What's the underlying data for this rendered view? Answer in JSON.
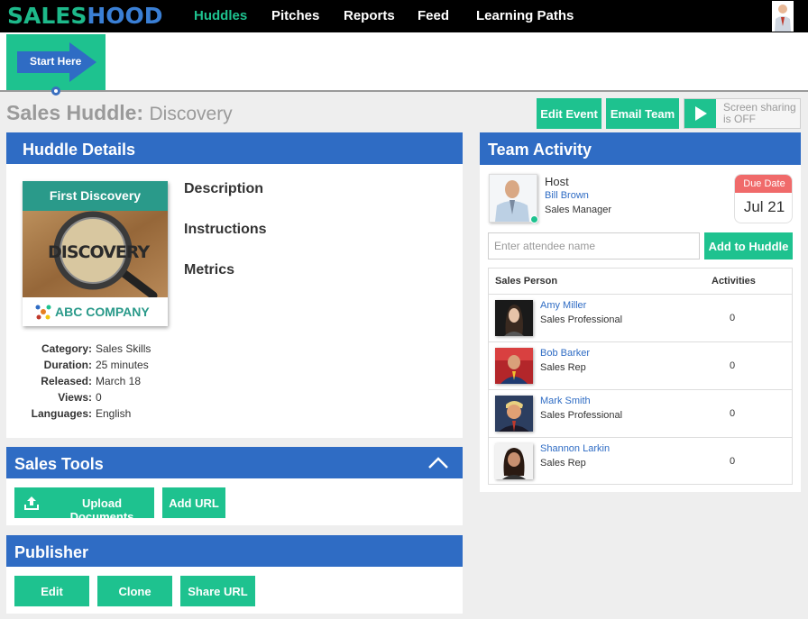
{
  "brand": {
    "logo_part1": "SALES",
    "logo_part2": "HOOD"
  },
  "nav": {
    "items": [
      {
        "label": "Huddles",
        "active": true
      },
      {
        "label": "Pitches",
        "active": false
      },
      {
        "label": "Reports",
        "active": false
      },
      {
        "label": "Feed",
        "active": false
      },
      {
        "label": "Learning Paths",
        "active": false
      }
    ]
  },
  "start_here": {
    "label": "Start Here"
  },
  "page": {
    "title_label": "Sales Huddle:",
    "title_value": "Discovery"
  },
  "actions": {
    "edit_event": "Edit Event",
    "email_team": "Email Team",
    "screen_sharing_line1": "Screen sharing",
    "screen_sharing_line2": "is OFF"
  },
  "huddle_details": {
    "header": "Huddle Details",
    "cover": {
      "title": "First Discovery",
      "image_text": "DISCOVERY",
      "company": "ABC COMPANY"
    },
    "sections": [
      "Description",
      "Instructions",
      "Metrics"
    ],
    "meta": [
      {
        "key": "Category:",
        "value": "Sales Skills"
      },
      {
        "key": "Duration:",
        "value": "25 minutes"
      },
      {
        "key": "Released:",
        "value": "March 18"
      },
      {
        "key": "Views:",
        "value": "0"
      },
      {
        "key": "Languages:",
        "value": "English"
      }
    ]
  },
  "sales_tools": {
    "header": "Sales Tools",
    "upload_label": "Upload Documents",
    "add_url_label": "Add URL",
    "icon": "chevron-up-icon"
  },
  "publisher": {
    "header": "Publisher",
    "edit_label": "Edit",
    "clone_label": "Clone",
    "share_url_label": "Share URL"
  },
  "team_activity": {
    "header": "Team Activity",
    "host": {
      "role_label": "Host",
      "name": "Bill Brown",
      "title": "Sales Manager"
    },
    "due": {
      "label": "Due Date",
      "date": "Jul 21"
    },
    "attendee_placeholder": "Enter attendee name",
    "add_button": "Add to Huddle",
    "table": {
      "col_person": "Sales Person",
      "col_activities": "Activities",
      "rows": [
        {
          "name": "Amy Miller",
          "role": "Sales Professional",
          "activities": "0"
        },
        {
          "name": "Bob Barker",
          "role": "Sales Rep",
          "activities": "0"
        },
        {
          "name": "Mark Smith",
          "role": "Sales Professional",
          "activities": "0"
        },
        {
          "name": "Shannon Larkin",
          "role": "Sales Rep",
          "activities": "0"
        }
      ]
    }
  },
  "colors": {
    "accent_green": "#1ec28f",
    "header_blue": "#2f6cc4",
    "due_red": "#f06a6a"
  }
}
